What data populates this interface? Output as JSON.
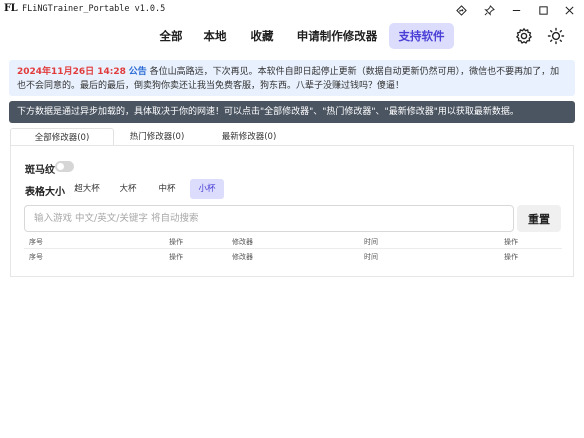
{
  "window": {
    "logo": "FL",
    "title": "FLiNGTrainer_Portable v1.0.5"
  },
  "title_controls": [
    "navigate-icon",
    "pin-icon",
    "minimize-icon",
    "maximize-icon",
    "close-icon"
  ],
  "nav": {
    "items": [
      {
        "label": "全部"
      },
      {
        "label": "本地"
      },
      {
        "label": "收藏"
      },
      {
        "label": "申请制作修改器"
      },
      {
        "label": "支持软件"
      }
    ],
    "active_index": 4,
    "icons": [
      "settings-icon",
      "theme-sun-icon"
    ]
  },
  "announcement": {
    "date": "2024年11月26日 14:28",
    "tag": "公告",
    "text": "各位山高路远，下次再见。本软件自即日起停止更新（数据自动更新仍然可用），微信也不要再加了，加也不会同意的。最后的最后，倒卖狗你卖还让我当免费客服，狗东西。八辈子没赚过钱吗？傻逼！"
  },
  "info_bar": {
    "text": "下方数据是通过异步加载的，具体取决于你的网速！可以点击\"全部修改器\"、\"热门修改器\"、\"最新修改器\"用以获取最新数据。"
  },
  "tabs": [
    {
      "label": "全部修改器(0)"
    },
    {
      "label": "热门修改器(0)"
    },
    {
      "label": "最新修改器(0)"
    }
  ],
  "active_tab_index": 0,
  "panel": {
    "zebra_label": "斑马纹",
    "zebra_on": false,
    "size_label": "表格大小",
    "size_options": [
      "超大杯",
      "大杯",
      "中杯",
      "小杯"
    ],
    "size_active_index": 3,
    "search_placeholder": "输入游戏 中文/英文/关键字 将自动搜索",
    "search_value": "",
    "reset_label": "重置",
    "columns": [
      "序号",
      "操作",
      "修改器",
      "时间",
      "操作"
    ]
  },
  "colors": {
    "accent": "#4a3fd6",
    "accent_bg": "#dcdcfd",
    "announce_bg": "#e8f1fd",
    "announce_date": "#e23b3b",
    "announce_tag": "#2a6bd6",
    "info_bar_bg": "#4b5562"
  }
}
